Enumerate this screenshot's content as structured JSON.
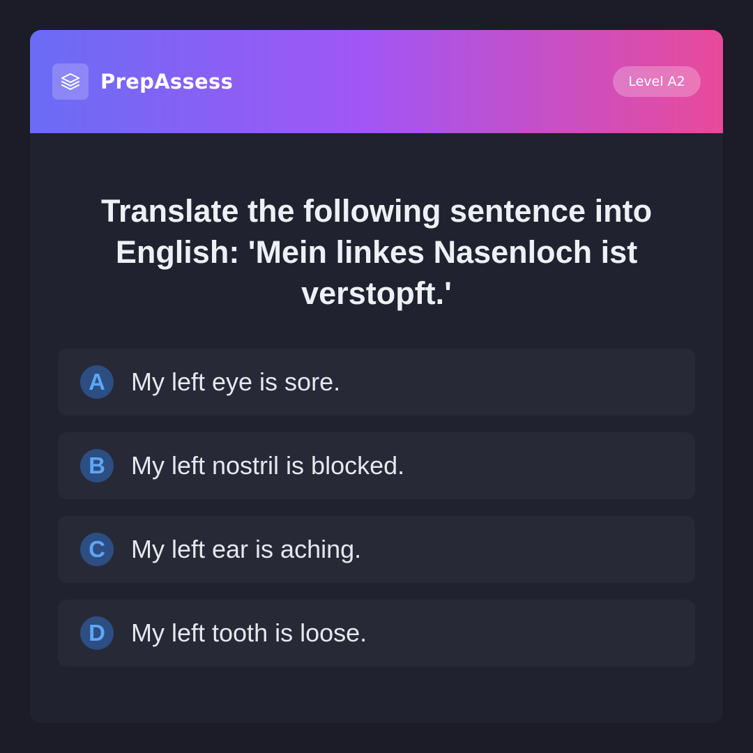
{
  "app": {
    "brand": "PrepAssess",
    "logo_icon": "layers-icon",
    "level_badge": "Level A2"
  },
  "question": {
    "text": "Translate the following sentence into English: 'Mein linkes Nasenloch ist verstopft.'"
  },
  "options": [
    {
      "letter": "A",
      "text": "My left eye is sore."
    },
    {
      "letter": "B",
      "text": "My left nostril is blocked."
    },
    {
      "letter": "C",
      "text": "My left ear is aching."
    },
    {
      "letter": "D",
      "text": "My left tooth is loose."
    }
  ],
  "colors": {
    "background": "#1b1c28",
    "card": "#20222f",
    "option_bg": "#272937",
    "gradient_start": "#6a6cf5",
    "gradient_mid": "#a156f5",
    "gradient_end": "#e94a9a",
    "letter_bg": "#2c4e82",
    "letter_fg": "#5ea6f5"
  }
}
